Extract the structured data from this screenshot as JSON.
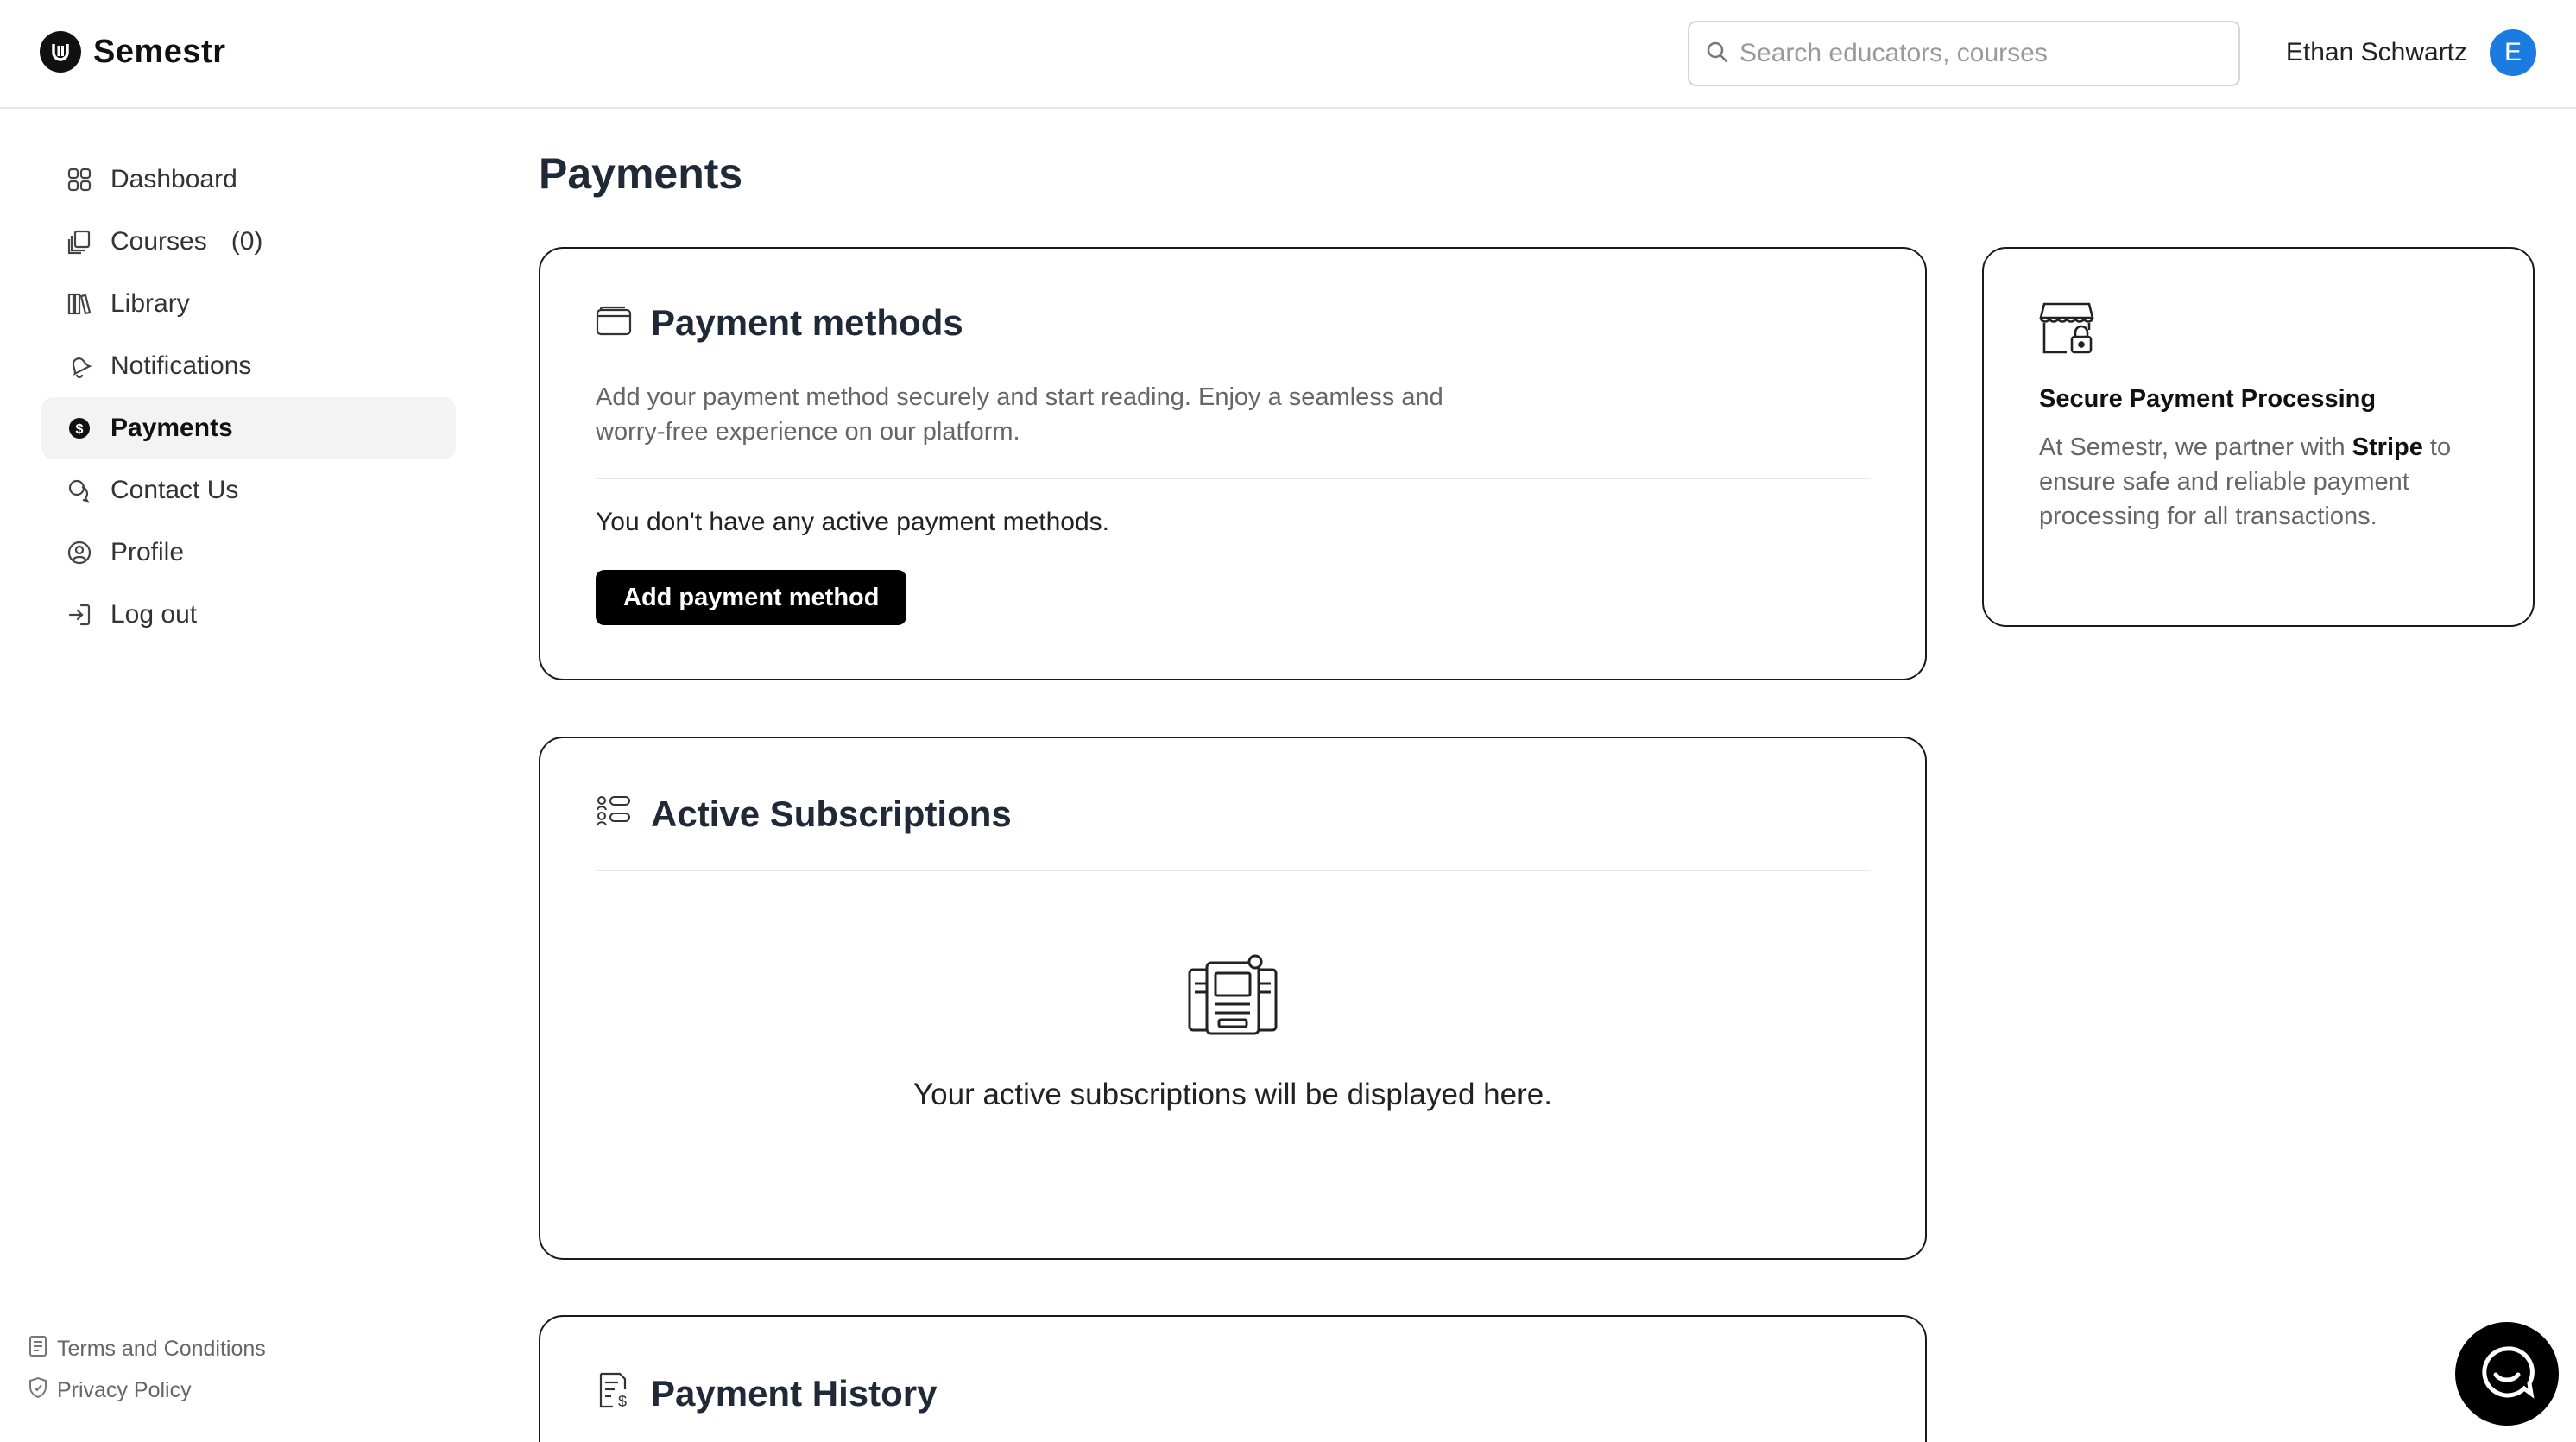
{
  "header": {
    "brand": "Semestr",
    "search_placeholder": "Search educators, courses",
    "user_name": "Ethan Schwartz",
    "avatar_initial": "E",
    "avatar_color": "#1a7be0"
  },
  "sidebar": {
    "items": [
      {
        "label": "Dashboard",
        "icon": "grid-icon"
      },
      {
        "label": "Courses",
        "count": "(0)",
        "icon": "courses-icon"
      },
      {
        "label": "Library",
        "icon": "library-icon"
      },
      {
        "label": "Notifications",
        "icon": "bell-icon"
      },
      {
        "label": "Payments",
        "icon": "dollar-icon",
        "active": true
      },
      {
        "label": "Contact Us",
        "icon": "chat-icon"
      },
      {
        "label": "Profile",
        "icon": "user-circle-icon"
      },
      {
        "label": "Log out",
        "icon": "logout-icon"
      }
    ],
    "footer": {
      "terms": "Terms and Conditions",
      "privacy": "Privacy Policy"
    }
  },
  "main": {
    "page_title": "Payments",
    "payment_methods": {
      "title": "Payment methods",
      "description": "Add your payment method securely and start reading. Enjoy a seamless and worry-free experience on our platform.",
      "empty_text": "You don't have any active payment methods.",
      "add_button": "Add payment method"
    },
    "active_subscriptions": {
      "title": "Active Subscriptions",
      "empty_text": "Your active subscriptions will be displayed here."
    },
    "payment_history": {
      "title": "Payment History"
    },
    "secure_card": {
      "title": "Secure Payment Processing",
      "body_prefix": "At Semestr, we partner with ",
      "body_bold": "Stripe",
      "body_suffix": " to ensure safe and reliable payment processing for all transactions."
    }
  }
}
